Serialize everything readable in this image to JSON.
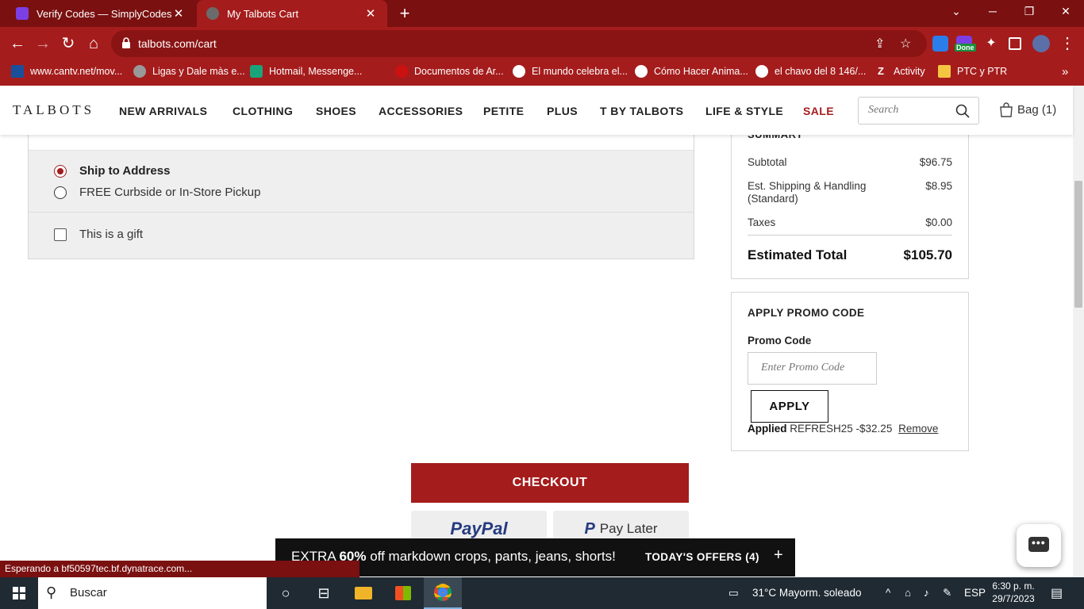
{
  "browser": {
    "tabs": [
      {
        "label": "Verify Codes — SimplyCodes",
        "active": false,
        "favicon_color": "#7b3fe4"
      },
      {
        "label": "My Talbots Cart",
        "active": true,
        "favicon_color": "#6b6b6b"
      }
    ],
    "url": "talbots.com/cart",
    "bookmarks": [
      {
        "label": "www.cantv.net/mov...",
        "icon_color": "#1a4f9c"
      },
      {
        "label": "Ligas y Dale màs e...",
        "icon_color": "#999999"
      },
      {
        "label": "Hotmail, Messenge...",
        "icon_color": "#1ba37a"
      },
      {
        "label": "Documentos de Ar...",
        "icon_color": "#333333"
      },
      {
        "label": "El mundo celebra el...",
        "icon_color": "#cc1111"
      },
      {
        "label": "Cómo Hacer Anima...",
        "icon_color": "#ffffff"
      },
      {
        "label": "el chavo del 8 146/...",
        "icon_color": "#ffffff"
      },
      {
        "label": "Activity",
        "icon_color": "#ffffff"
      },
      {
        "label": "PTC y PTR",
        "icon_color": "#f5c542"
      }
    ],
    "extension_badge": "Done",
    "status_text": "Esperando a bf50597tec.bf.dynatrace.com..."
  },
  "site": {
    "logo": "TALBOTS",
    "nav": [
      "NEW ARRIVALS",
      "CLOTHING",
      "SHOES",
      "ACCESSORIES",
      "PETITE",
      "PLUS",
      "T BY TALBOTS",
      "LIFE & STYLE",
      "SALE"
    ],
    "sale_color": "#a51c1c",
    "search_placeholder": "Search",
    "bag_label": "Bag (1)"
  },
  "shipping": {
    "options": [
      {
        "label": "Ship to Address",
        "selected": true
      },
      {
        "label": "FREE Curbside or In-Store Pickup",
        "selected": false
      }
    ],
    "gift_label": "This is a gift",
    "gift_checked": false
  },
  "summary": {
    "title": "SUMMARY",
    "rows": [
      {
        "label": "Subtotal",
        "value": "$96.75"
      },
      {
        "label": "Est. Shipping & Handling (Standard)",
        "value": "$8.95"
      },
      {
        "label": "Taxes",
        "value": "$0.00"
      }
    ],
    "total_label": "Estimated Total",
    "total_value": "$105.70"
  },
  "promo": {
    "title": "APPLY PROMO CODE",
    "field_label": "Promo Code",
    "placeholder": "Enter Promo Code",
    "apply_label": "APPLY",
    "applied_label": "Applied",
    "applied_code": "REFRESH25 -$32.25",
    "remove_label": "Remove"
  },
  "checkout": {
    "checkout_label": "CHECKOUT",
    "paypal_label": "PayPal",
    "paylater_label": "Pay Later"
  },
  "offer_bar": {
    "prefix": "EXTRA ",
    "highlight": "60%",
    "suffix": " off markdown crops, pants, jeans, shorts!",
    "button_label": "TODAY'S OFFERS (4)",
    "plus": "+"
  },
  "taskbar": {
    "search_label": "Buscar",
    "weather": "31°C  Mayorm. soleado",
    "language": "ESP",
    "time": "6:30 p. m.",
    "date": "29/7/2023"
  },
  "colors": {
    "brand_red": "#a51c1c",
    "tab_bar": "#7a1010"
  }
}
